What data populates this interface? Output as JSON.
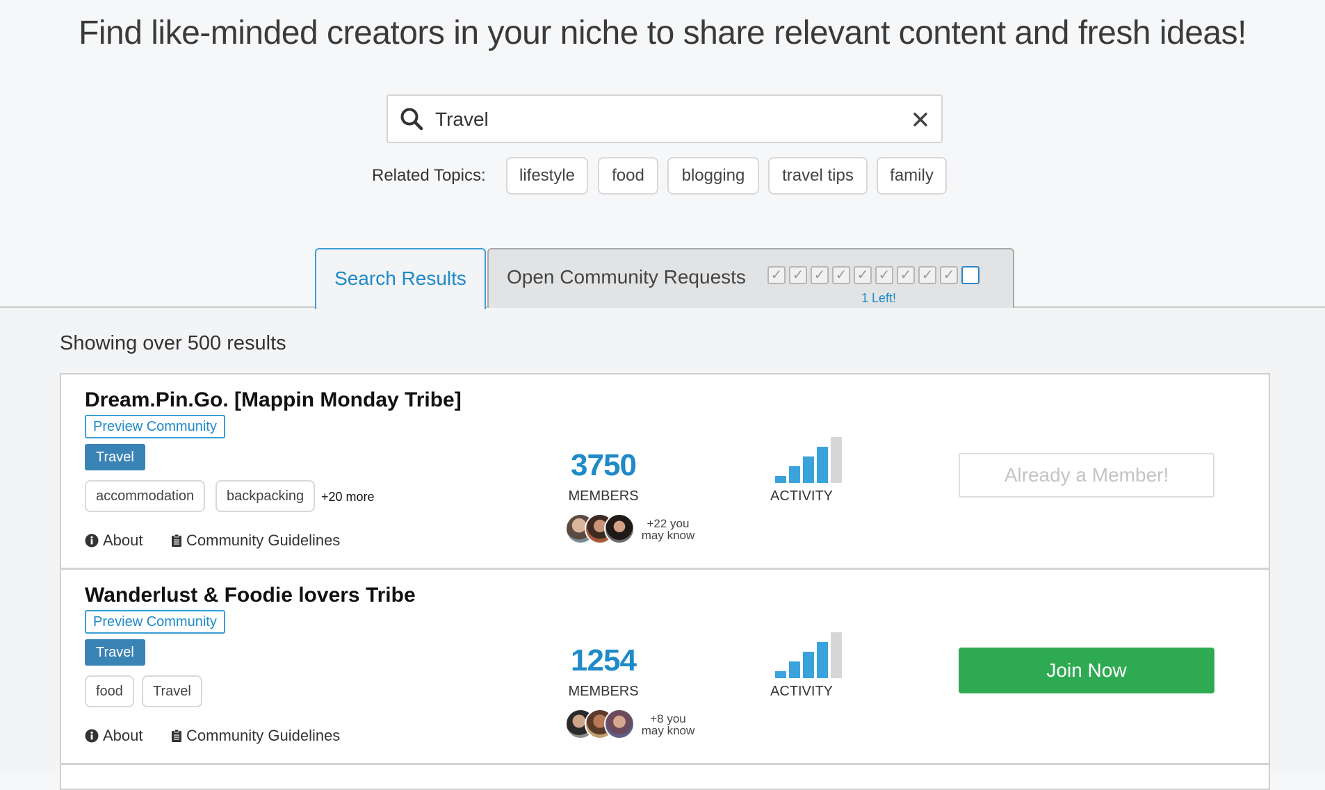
{
  "headline": "Find like-minded creators in your niche to share relevant content and fresh ideas!",
  "search": {
    "value": "Travel"
  },
  "related": {
    "label": "Related Topics:",
    "topics": [
      "lifestyle",
      "food",
      "blogging",
      "travel tips",
      "family"
    ]
  },
  "tabs": {
    "search_results": "Search Results",
    "open_requests": "Open Community Requests",
    "requests_total": 10,
    "requests_used": 9,
    "requests_left_label": "1 Left!"
  },
  "results": {
    "count_label": "Showing over 500 results",
    "communities": [
      {
        "title": "Dream.Pin.Go. [Mappin Monday Tribe]",
        "preview_label": "Preview Community",
        "category": "Travel",
        "tags": [
          "accommodation",
          "backpacking"
        ],
        "more_tags": "+20 more",
        "about_label": "About",
        "guidelines_label": "Community Guidelines",
        "members": "3750",
        "members_label": "MEMBERS",
        "know_line1": "+22 you",
        "know_line2": "may know",
        "activity_label": "ACTIVITY",
        "activity_level": 4,
        "action_label": "Already a Member!",
        "action_state": "member"
      },
      {
        "title": "Wanderlust & Foodie lovers Tribe",
        "preview_label": "Preview Community",
        "category": "Travel",
        "tags": [
          "food",
          "Travel"
        ],
        "more_tags": "",
        "about_label": "About",
        "guidelines_label": "Community Guidelines",
        "members": "1254",
        "members_label": "MEMBERS",
        "know_line1": "+8 you",
        "know_line2": "may know",
        "activity_label": "ACTIVITY",
        "activity_level": 4,
        "action_label": "Join Now",
        "action_state": "join"
      }
    ]
  },
  "colors": {
    "accent": "#1e8ac8",
    "category_bg": "#3a83b5",
    "join_green": "#2eaa52",
    "activity_on": "#3aa3dc",
    "activity_off": "#d6d6d6"
  },
  "icons": {
    "search": "search-icon",
    "clear": "close-icon",
    "about": "info-icon",
    "guidelines": "clipboard-icon",
    "activity": "activity-bars-icon"
  }
}
